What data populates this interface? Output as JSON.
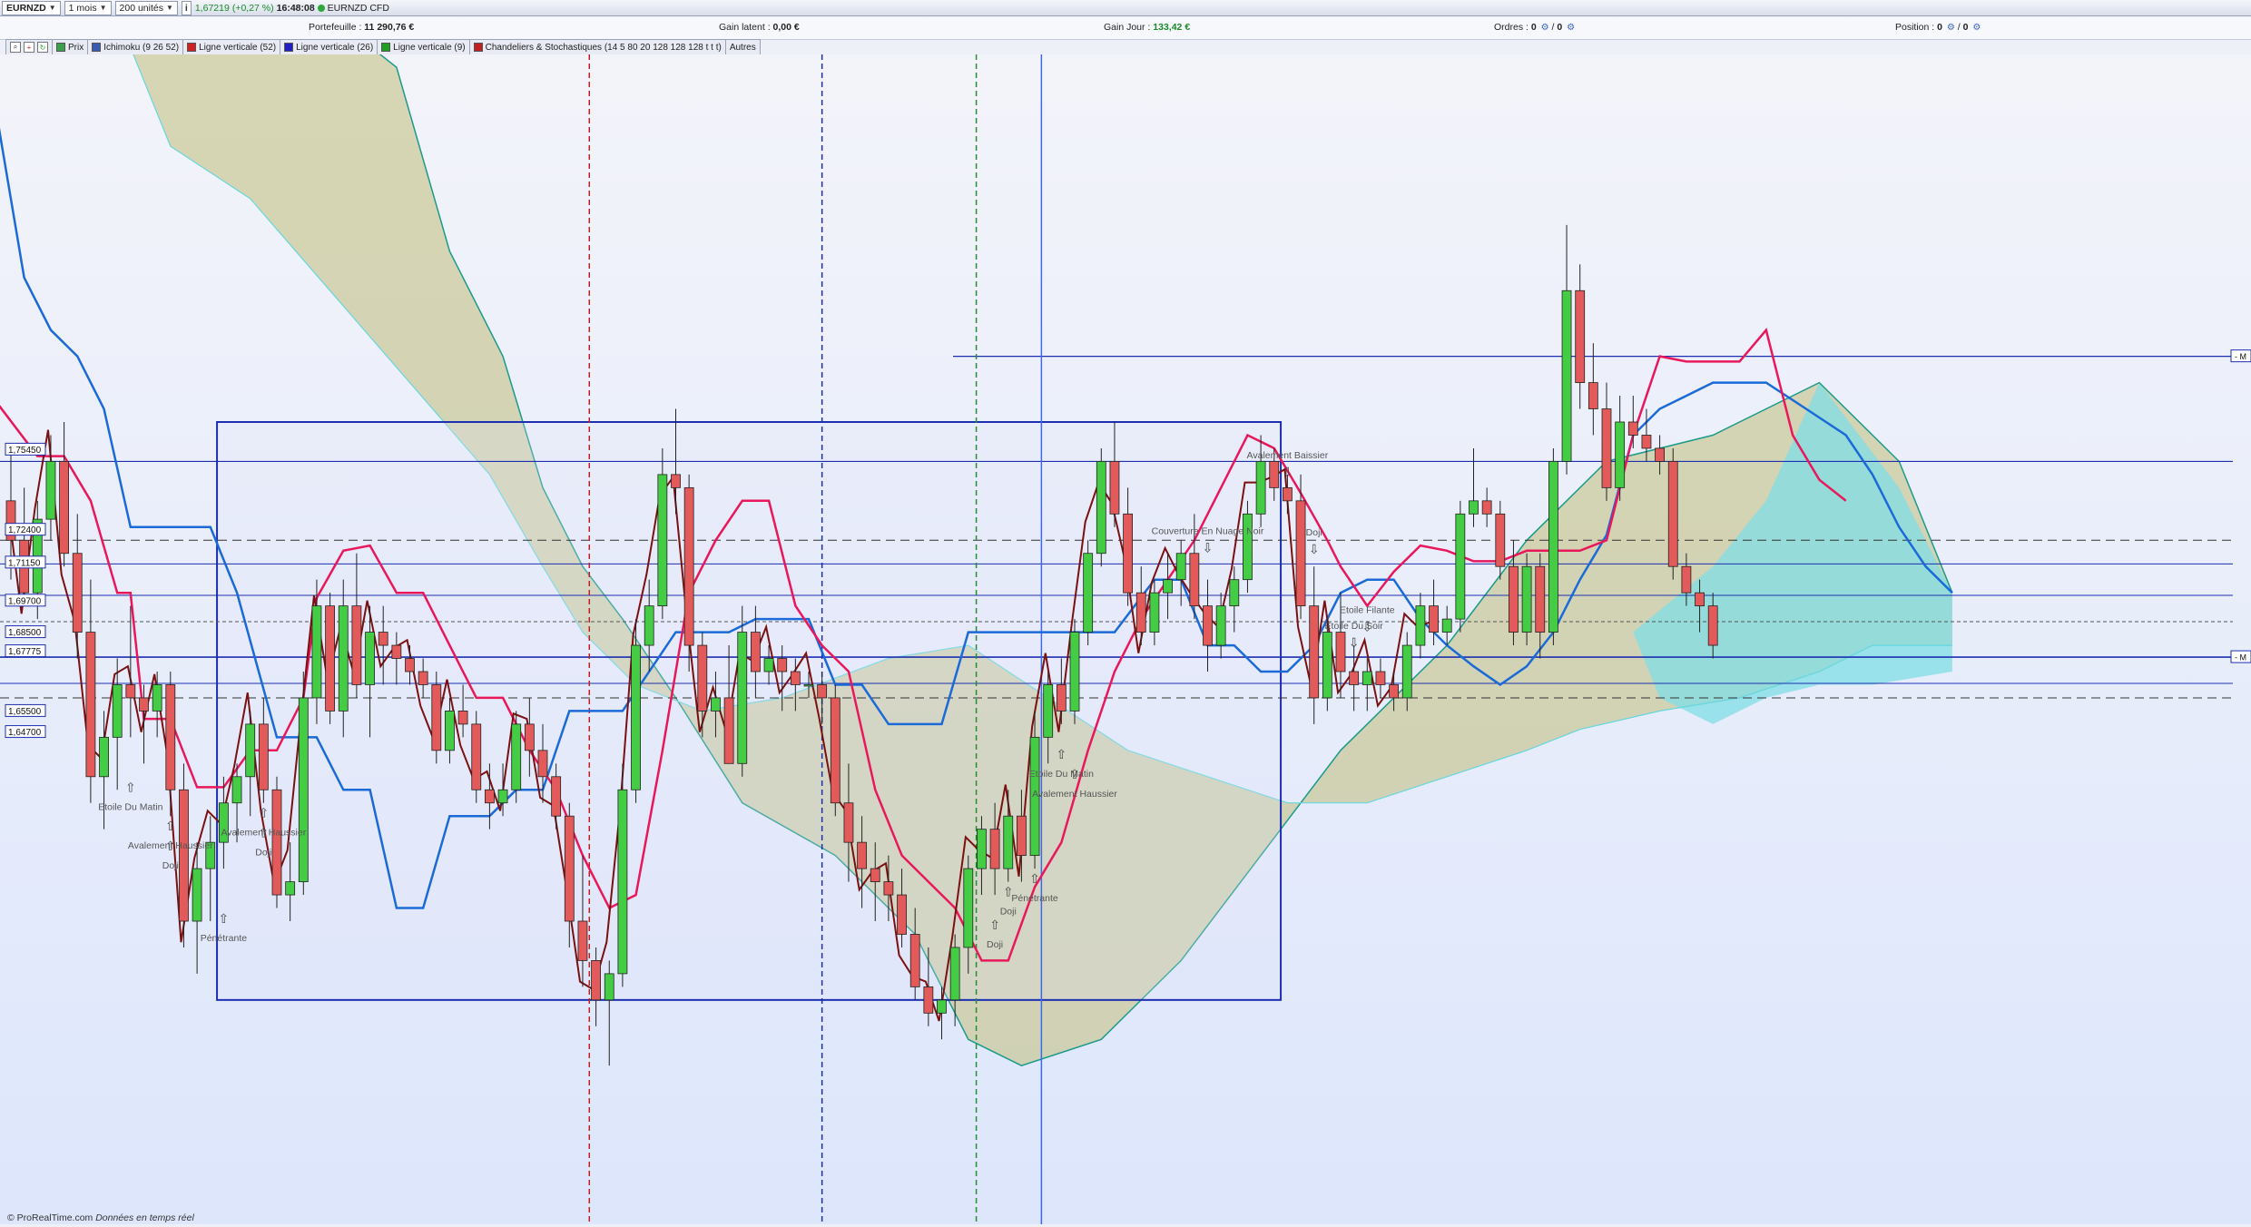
{
  "toolbar": {
    "symbol": "EURNZD",
    "timeframe": "1 mois",
    "units": "200 unités",
    "price": "1,67219",
    "change": "(+0,27 %)",
    "time": "16:48:08",
    "instrument": "EURNZD CFD"
  },
  "infobar": {
    "portfolio_label": "Portefeuille :",
    "portfolio_value": "11 290,76 €",
    "latent_label": "Gain latent :",
    "latent_value": "0,00 €",
    "day_gain_label": "Gain Jour :",
    "day_gain_value": "133,42 €",
    "orders_label": "Ordres :",
    "orders_value_a": "0",
    "orders_value_b": "0",
    "position_label": "Position :",
    "position_value_a": "0",
    "position_value_b": "0"
  },
  "legend": [
    {
      "label": "Prix",
      "color": "#3aa04a"
    },
    {
      "label": "Ichimoku (9 26 52)",
      "color": "#3a5bb0"
    },
    {
      "label": "Ligne verticale (52)",
      "color": "#d02020"
    },
    {
      "label": "Ligne verticale (26)",
      "color": "#2020c0"
    },
    {
      "label": "Ligne verticale (9)",
      "color": "#20a020"
    },
    {
      "label": "Chandeliers & Stochastiques (14 5 80 20 128 128 128 t t t)",
      "color": "#c02020"
    },
    {
      "label": "Autres",
      "color": ""
    }
  ],
  "footer": {
    "brand": "© ProRealTime.com",
    "note": "Données en temps réel"
  },
  "chart_data": {
    "type": "candlestick",
    "price_labels": [
      "1,75450",
      "1,72400",
      "1,71150",
      "1,69700",
      "1,68500",
      "1,67775",
      "1,65500",
      "1,64700"
    ],
    "right_markers": [
      "M",
      "M"
    ],
    "annotations": [
      {
        "text": "Avalement Haussier",
        "candle": 12
      },
      {
        "text": "Doji",
        "candle": 12
      },
      {
        "text": "Etoile Du Matin",
        "candle": 9
      },
      {
        "text": "Avalement Haussier",
        "candle": 19
      },
      {
        "text": "Doji",
        "candle": 19
      },
      {
        "text": "Pénétrante",
        "candle": 16
      },
      {
        "text": "Doji",
        "candle": 75
      },
      {
        "text": "Doji",
        "candle": 74
      },
      {
        "text": "Avalement Haussier",
        "candle": 80
      },
      {
        "text": "Pénétrante",
        "candle": 77
      },
      {
        "text": "Etoile Du Matin",
        "candle": 79
      },
      {
        "text": "Couverture En Nuage Noir",
        "candle": 90
      },
      {
        "text": "Avalement Baissier",
        "candle": 96
      },
      {
        "text": "Doji",
        "candle": 98
      },
      {
        "text": "Etoile Filante",
        "candle": 102
      },
      {
        "text": "Etoile Du Soir",
        "candle": 101
      }
    ],
    "candles": [
      [
        1.735,
        1.755,
        1.705,
        1.72
      ],
      [
        1.72,
        1.74,
        1.695,
        1.7
      ],
      [
        1.7,
        1.735,
        1.69,
        1.728
      ],
      [
        1.728,
        1.76,
        1.72,
        1.75
      ],
      [
        1.75,
        1.765,
        1.71,
        1.715
      ],
      [
        1.715,
        1.73,
        1.675,
        1.685
      ],
      [
        1.685,
        1.705,
        1.62,
        1.63
      ],
      [
        1.63,
        1.655,
        1.61,
        1.645
      ],
      [
        1.645,
        1.675,
        1.625,
        1.665
      ],
      [
        1.665,
        1.695,
        1.645,
        1.66
      ],
      [
        1.66,
        1.665,
        1.635,
        1.655
      ],
      [
        1.655,
        1.67,
        1.645,
        1.665
      ],
      [
        1.665,
        1.67,
        1.615,
        1.625
      ],
      [
        1.625,
        1.635,
        1.565,
        1.575
      ],
      [
        1.575,
        1.605,
        1.555,
        1.595
      ],
      [
        1.595,
        1.615,
        1.575,
        1.605
      ],
      [
        1.605,
        1.63,
        1.595,
        1.62
      ],
      [
        1.62,
        1.635,
        1.605,
        1.63
      ],
      [
        1.63,
        1.655,
        1.615,
        1.65
      ],
      [
        1.65,
        1.66,
        1.62,
        1.625
      ],
      [
        1.625,
        1.63,
        1.58,
        1.585
      ],
      [
        1.585,
        1.605,
        1.575,
        1.59
      ],
      [
        1.59,
        1.67,
        1.585,
        1.66
      ],
      [
        1.66,
        1.705,
        1.65,
        1.695
      ],
      [
        1.695,
        1.7,
        1.65,
        1.655
      ],
      [
        1.655,
        1.705,
        1.645,
        1.695
      ],
      [
        1.695,
        1.715,
        1.66,
        1.665
      ],
      [
        1.665,
        1.695,
        1.645,
        1.685
      ],
      [
        1.685,
        1.695,
        1.665,
        1.68
      ],
      [
        1.68,
        1.685,
        1.665,
        1.675
      ],
      [
        1.675,
        1.68,
        1.665,
        1.67
      ],
      [
        1.67,
        1.675,
        1.66,
        1.665
      ],
      [
        1.665,
        1.67,
        1.635,
        1.64
      ],
      [
        1.64,
        1.66,
        1.635,
        1.655
      ],
      [
        1.655,
        1.665,
        1.645,
        1.65
      ],
      [
        1.65,
        1.655,
        1.62,
        1.625
      ],
      [
        1.625,
        1.635,
        1.61,
        1.62
      ],
      [
        1.62,
        1.635,
        1.615,
        1.625
      ],
      [
        1.625,
        1.655,
        1.62,
        1.65
      ],
      [
        1.65,
        1.66,
        1.63,
        1.64
      ],
      [
        1.64,
        1.65,
        1.62,
        1.63
      ],
      [
        1.63,
        1.635,
        1.61,
        1.615
      ],
      [
        1.615,
        1.62,
        1.565,
        1.575
      ],
      [
        1.575,
        1.6,
        1.55,
        1.56
      ],
      [
        1.56,
        1.565,
        1.535,
        1.545
      ],
      [
        1.545,
        1.56,
        1.52,
        1.555
      ],
      [
        1.555,
        1.635,
        1.55,
        1.625
      ],
      [
        1.625,
        1.69,
        1.62,
        1.68
      ],
      [
        1.68,
        1.705,
        1.67,
        1.695
      ],
      [
        1.695,
        1.755,
        1.69,
        1.745
      ],
      [
        1.745,
        1.77,
        1.73,
        1.74
      ],
      [
        1.74,
        1.745,
        1.67,
        1.68
      ],
      [
        1.68,
        1.685,
        1.645,
        1.655
      ],
      [
        1.655,
        1.67,
        1.645,
        1.66
      ],
      [
        1.66,
        1.68,
        1.635,
        1.635
      ],
      [
        1.635,
        1.695,
        1.63,
        1.685
      ],
      [
        1.685,
        1.695,
        1.66,
        1.67
      ],
      [
        1.67,
        1.68,
        1.665,
        1.675
      ],
      [
        1.675,
        1.68,
        1.655,
        1.67
      ],
      [
        1.67,
        1.675,
        1.655,
        1.665
      ],
      [
        1.665,
        1.67,
        1.66,
        1.665
      ],
      [
        1.665,
        1.67,
        1.65,
        1.66
      ],
      [
        1.66,
        1.665,
        1.615,
        1.62
      ],
      [
        1.62,
        1.635,
        1.59,
        1.605
      ],
      [
        1.605,
        1.615,
        1.58,
        1.595
      ],
      [
        1.595,
        1.605,
        1.575,
        1.59
      ],
      [
        1.59,
        1.6,
        1.575,
        1.585
      ],
      [
        1.585,
        1.595,
        1.565,
        1.57
      ],
      [
        1.57,
        1.58,
        1.545,
        1.55
      ],
      [
        1.55,
        1.565,
        1.535,
        1.54
      ],
      [
        1.54,
        1.55,
        1.53,
        1.545
      ],
      [
        1.545,
        1.57,
        1.535,
        1.565
      ],
      [
        1.565,
        1.6,
        1.555,
        1.595
      ],
      [
        1.595,
        1.615,
        1.585,
        1.61
      ],
      [
        1.61,
        1.62,
        1.585,
        1.595
      ],
      [
        1.595,
        1.625,
        1.59,
        1.615
      ],
      [
        1.615,
        1.625,
        1.59,
        1.6
      ],
      [
        1.6,
        1.655,
        1.595,
        1.645
      ],
      [
        1.645,
        1.67,
        1.635,
        1.665
      ],
      [
        1.665,
        1.675,
        1.65,
        1.655
      ],
      [
        1.655,
        1.69,
        1.65,
        1.685
      ],
      [
        1.685,
        1.72,
        1.68,
        1.715
      ],
      [
        1.715,
        1.755,
        1.71,
        1.75
      ],
      [
        1.75,
        1.765,
        1.725,
        1.73
      ],
      [
        1.73,
        1.74,
        1.695,
        1.7
      ],
      [
        1.7,
        1.71,
        1.68,
        1.685
      ],
      [
        1.685,
        1.705,
        1.68,
        1.7
      ],
      [
        1.7,
        1.715,
        1.69,
        1.705
      ],
      [
        1.705,
        1.72,
        1.695,
        1.715
      ],
      [
        1.715,
        1.73,
        1.69,
        1.695
      ],
      [
        1.695,
        1.705,
        1.67,
        1.68
      ],
      [
        1.68,
        1.7,
        1.675,
        1.695
      ],
      [
        1.695,
        1.71,
        1.685,
        1.705
      ],
      [
        1.705,
        1.735,
        1.7,
        1.73
      ],
      [
        1.73,
        1.76,
        1.725,
        1.75
      ],
      [
        1.75,
        1.755,
        1.735,
        1.74
      ],
      [
        1.74,
        1.745,
        1.73,
        1.735
      ],
      [
        1.735,
        1.745,
        1.69,
        1.695
      ],
      [
        1.695,
        1.71,
        1.65,
        1.66
      ],
      [
        1.66,
        1.69,
        1.655,
        1.685
      ],
      [
        1.685,
        1.7,
        1.66,
        1.67
      ],
      [
        1.67,
        1.68,
        1.655,
        1.665
      ],
      [
        1.665,
        1.675,
        1.655,
        1.67
      ],
      [
        1.67,
        1.675,
        1.66,
        1.665
      ],
      [
        1.665,
        1.67,
        1.655,
        1.66
      ],
      [
        1.66,
        1.685,
        1.655,
        1.68
      ],
      [
        1.68,
        1.7,
        1.675,
        1.695
      ],
      [
        1.695,
        1.705,
        1.68,
        1.685
      ],
      [
        1.685,
        1.695,
        1.68,
        1.69
      ],
      [
        1.69,
        1.735,
        1.685,
        1.73
      ],
      [
        1.73,
        1.755,
        1.725,
        1.735
      ],
      [
        1.735,
        1.74,
        1.725,
        1.73
      ],
      [
        1.73,
        1.735,
        1.705,
        1.71
      ],
      [
        1.71,
        1.72,
        1.68,
        1.685
      ],
      [
        1.685,
        1.715,
        1.68,
        1.71
      ],
      [
        1.71,
        1.715,
        1.675,
        1.685
      ],
      [
        1.685,
        1.755,
        1.68,
        1.75
      ],
      [
        1.75,
        1.84,
        1.745,
        1.815
      ],
      [
        1.815,
        1.825,
        1.77,
        1.78
      ],
      [
        1.78,
        1.795,
        1.76,
        1.77
      ],
      [
        1.77,
        1.78,
        1.735,
        1.74
      ],
      [
        1.74,
        1.775,
        1.735,
        1.765
      ],
      [
        1.765,
        1.775,
        1.755,
        1.76
      ],
      [
        1.76,
        1.77,
        1.75,
        1.755
      ],
      [
        1.755,
        1.76,
        1.745,
        1.75
      ],
      [
        1.75,
        1.755,
        1.705,
        1.71
      ],
      [
        1.71,
        1.715,
        1.695,
        1.7
      ],
      [
        1.7,
        1.705,
        1.685,
        1.695
      ],
      [
        1.695,
        1.7,
        1.675,
        1.68
      ]
    ]
  }
}
